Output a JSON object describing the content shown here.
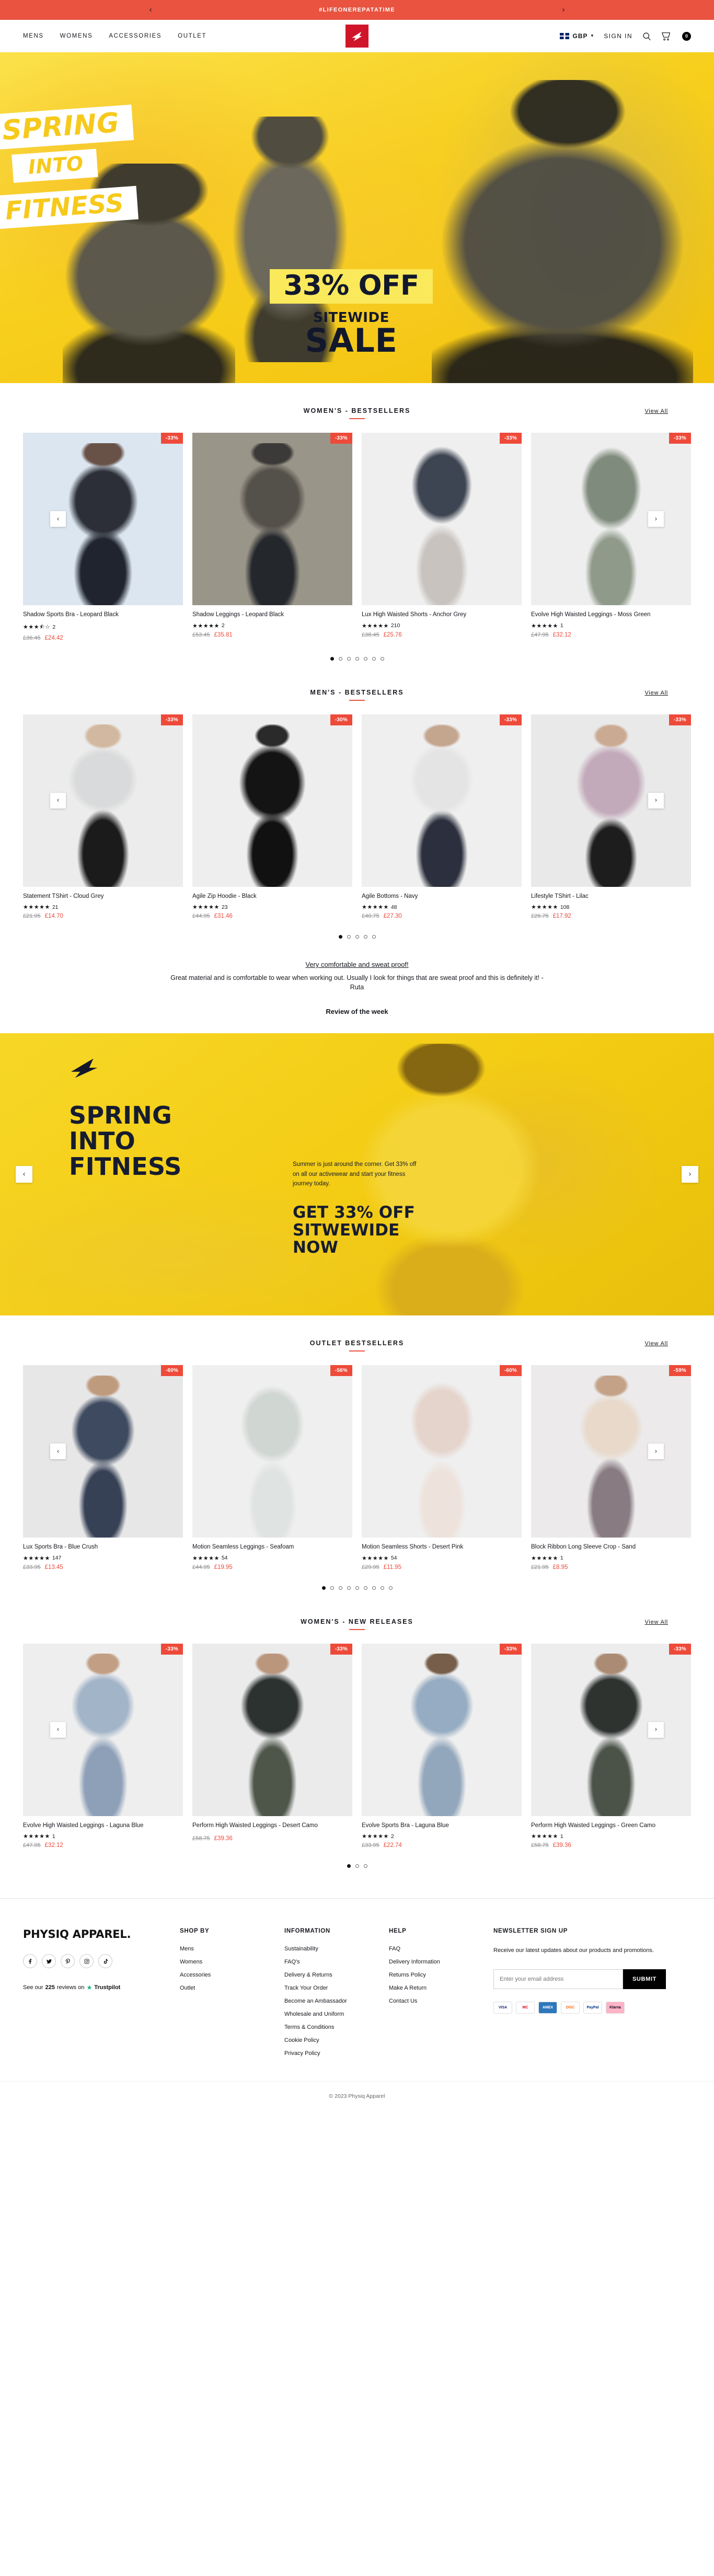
{
  "announce": {
    "text": "#LIFEONEREPATATIME",
    "prev": "‹",
    "next": "›",
    "bg": "#e9533f"
  },
  "header": {
    "nav": [
      {
        "label": "MENS"
      },
      {
        "label": "WOMENS"
      },
      {
        "label": "ACCESSORIES"
      },
      {
        "label": "OUTLET"
      }
    ],
    "currency": "GBP",
    "currency_chevron": "⌄",
    "signin": "SIGN IN",
    "cart_count": "0",
    "logo_bg": "#d0152b"
  },
  "hero": {
    "tag1": "SPRING",
    "tag2": "INTO",
    "tag3": "FITNESS",
    "offer": "33% OFF",
    "sitewide": "SITEWIDE",
    "sale": "SALE"
  },
  "sections": {
    "womens_bestsellers": {
      "title": "WOMEN'S - BESTSELLERS",
      "view_all": "View All",
      "prev": "‹",
      "next": "›",
      "dots_count": 7,
      "active_dot": 0,
      "products": [
        {
          "badge": "-33%",
          "title": "Shadow Sports Bra - Leopard Black",
          "stars": "★★★⯪☆",
          "reviews": "2",
          "price_old": "£36.45",
          "price_new": "£24.42"
        },
        {
          "badge": "-33%",
          "title": "Shadow Leggings - Leopard Black",
          "stars": "★★★★★",
          "reviews": "2",
          "price_old": "£53.45",
          "price_new": "£35.81"
        },
        {
          "badge": "-33%",
          "title": "Lux High Waisted Shorts - Anchor Grey",
          "stars": "★★★★★",
          "reviews": "210",
          "price_old": "£38.45",
          "price_new": "£25.76"
        },
        {
          "badge": "-33%",
          "title": "Evolve High Waisted Leggings - Moss Green",
          "stars": "★★★★★",
          "reviews": "1",
          "price_old": "£47.95",
          "price_new": "£32.12"
        }
      ]
    },
    "mens_bestsellers": {
      "title": "MEN'S - BESTSELLERS",
      "view_all": "View All",
      "prev": "‹",
      "next": "›",
      "dots_count": 5,
      "active_dot": 0,
      "products": [
        {
          "badge": "-33%",
          "title": "Statement TShirt - Cloud Grey",
          "stars": "★★★★★",
          "reviews": "21",
          "price_old": "£21.95",
          "price_new": "£14.70"
        },
        {
          "badge": "-30%",
          "title": "Agile Zip Hoodie - Black",
          "stars": "★★★★★",
          "reviews": "23",
          "price_old": "£44.95",
          "price_new": "£31.46"
        },
        {
          "badge": "-33%",
          "title": "Agile Bottoms - Navy",
          "stars": "★★★★★",
          "reviews": "48",
          "price_old": "£40.75",
          "price_new": "£27.30"
        },
        {
          "badge": "-33%",
          "title": "Lifestyle TShirt - Lilac",
          "stars": "★★★★★",
          "reviews": "108",
          "price_old": "£26.75",
          "price_new": "£17.92"
        }
      ]
    },
    "outlet_bestsellers": {
      "title": "OUTLET BESTSELLERS",
      "view_all": "View All",
      "prev": "‹",
      "next": "›",
      "dots_count": 9,
      "active_dot": 0,
      "products": [
        {
          "badge": "-60%",
          "title": "Lux Sports Bra - Blue Crush",
          "stars": "★★★★★",
          "reviews": "147",
          "price_old": "£33.95",
          "price_new": "£13.45"
        },
        {
          "badge": "-56%",
          "title": "Motion Seamless Leggings - Seafoam",
          "stars": "★★★★★",
          "reviews": "54",
          "price_old": "£44.95",
          "price_new": "£19.95"
        },
        {
          "badge": "-60%",
          "title": "Motion Seamless Shorts - Desert Pink",
          "stars": "★★★★★",
          "reviews": "54",
          "price_old": "£29.95",
          "price_new": "£11.95"
        },
        {
          "badge": "-59%",
          "title": "Block Ribbon Long Sleeve Crop - Sand",
          "stars": "★★★★★",
          "reviews": "1",
          "price_old": "£21.95",
          "price_new": "£8.95"
        }
      ]
    },
    "womens_new": {
      "title": "WOMEN'S - NEW RELEASES",
      "view_all": "View All",
      "prev": "‹",
      "next": "›",
      "dots_count": 3,
      "active_dot": 0,
      "products": [
        {
          "badge": "-33%",
          "title": "Evolve High Waisted Leggings - Laguna Blue",
          "stars": "★★★★★",
          "reviews": "1",
          "price_old": "£47.95",
          "price_new": "£32.12"
        },
        {
          "badge": "-33%",
          "title": "Perform High Waisted Leggings - Desert Camo",
          "stars": "",
          "reviews": "",
          "price_old": "£58.75",
          "price_new": "£39.36"
        },
        {
          "badge": "-33%",
          "title": "Evolve Sports Bra - Laguna Blue",
          "stars": "★★★★★",
          "reviews": "2",
          "price_old": "£33.95",
          "price_new": "£22.74"
        },
        {
          "badge": "-33%",
          "title": "Perform High Waisted Leggings - Green Camo",
          "stars": "★★★★★",
          "reviews": "1",
          "price_old": "£58.75",
          "price_new": "£39.36"
        }
      ]
    }
  },
  "review": {
    "title": "Very comfortable and sweat proof!",
    "body": "Great material and is comfortable to wear when working out. Usually I look for things that are sweat proof and this is definitely it! -",
    "author": "Ruta",
    "label": "Review of the week"
  },
  "promo": {
    "line1": "SPRING",
    "line2": "INTO",
    "line3": "FITNESS",
    "sub": "Summer is just around the corner. Get 33% off on all our activewear and start your fitness journey today.",
    "cta1": "GET 33% OFF",
    "cta2": "SITWEWIDE",
    "cta3": "NOW",
    "prev": "‹",
    "next": "›"
  },
  "footer": {
    "brand": "PHYSIQ APPAREL.",
    "socials": [
      {
        "name": "facebook-icon"
      },
      {
        "name": "twitter-icon"
      },
      {
        "name": "pinterest-icon"
      },
      {
        "name": "instagram-icon"
      },
      {
        "name": "tiktok-icon"
      }
    ],
    "trust_prefix": "See our",
    "trust_count": "225",
    "trust_mid": "reviews on",
    "trust_name": "Trustpilot",
    "columns": [
      {
        "heading": "SHOP BY",
        "links": [
          "Mens",
          "Womens",
          "Accessories",
          "Outlet"
        ]
      },
      {
        "heading": "INFORMATION",
        "links": [
          "Sustainability",
          "FAQ's",
          "Delivery & Returns",
          "Track Your Order",
          "Become an Ambassador",
          "Wholesale and Uniform",
          "Terms & Conditions",
          "Cookie Policy",
          "Privacy Policy"
        ]
      },
      {
        "heading": "HELP",
        "links": [
          "FAQ",
          "Delivery Information",
          "Returns Policy",
          "Make A Return",
          "Contact Us"
        ]
      }
    ],
    "newsletter": {
      "heading": "NEWSLETTER SIGN UP",
      "copy": "Receive our latest updates about our products and promotions.",
      "placeholder": "Enter your email address",
      "submit": "SUBMIT"
    },
    "payments": [
      "VISA",
      "MC",
      "AMEX",
      "DISC",
      "PayPal",
      "Klarna"
    ],
    "copyright": "© 2023 Physiq Apparel"
  }
}
